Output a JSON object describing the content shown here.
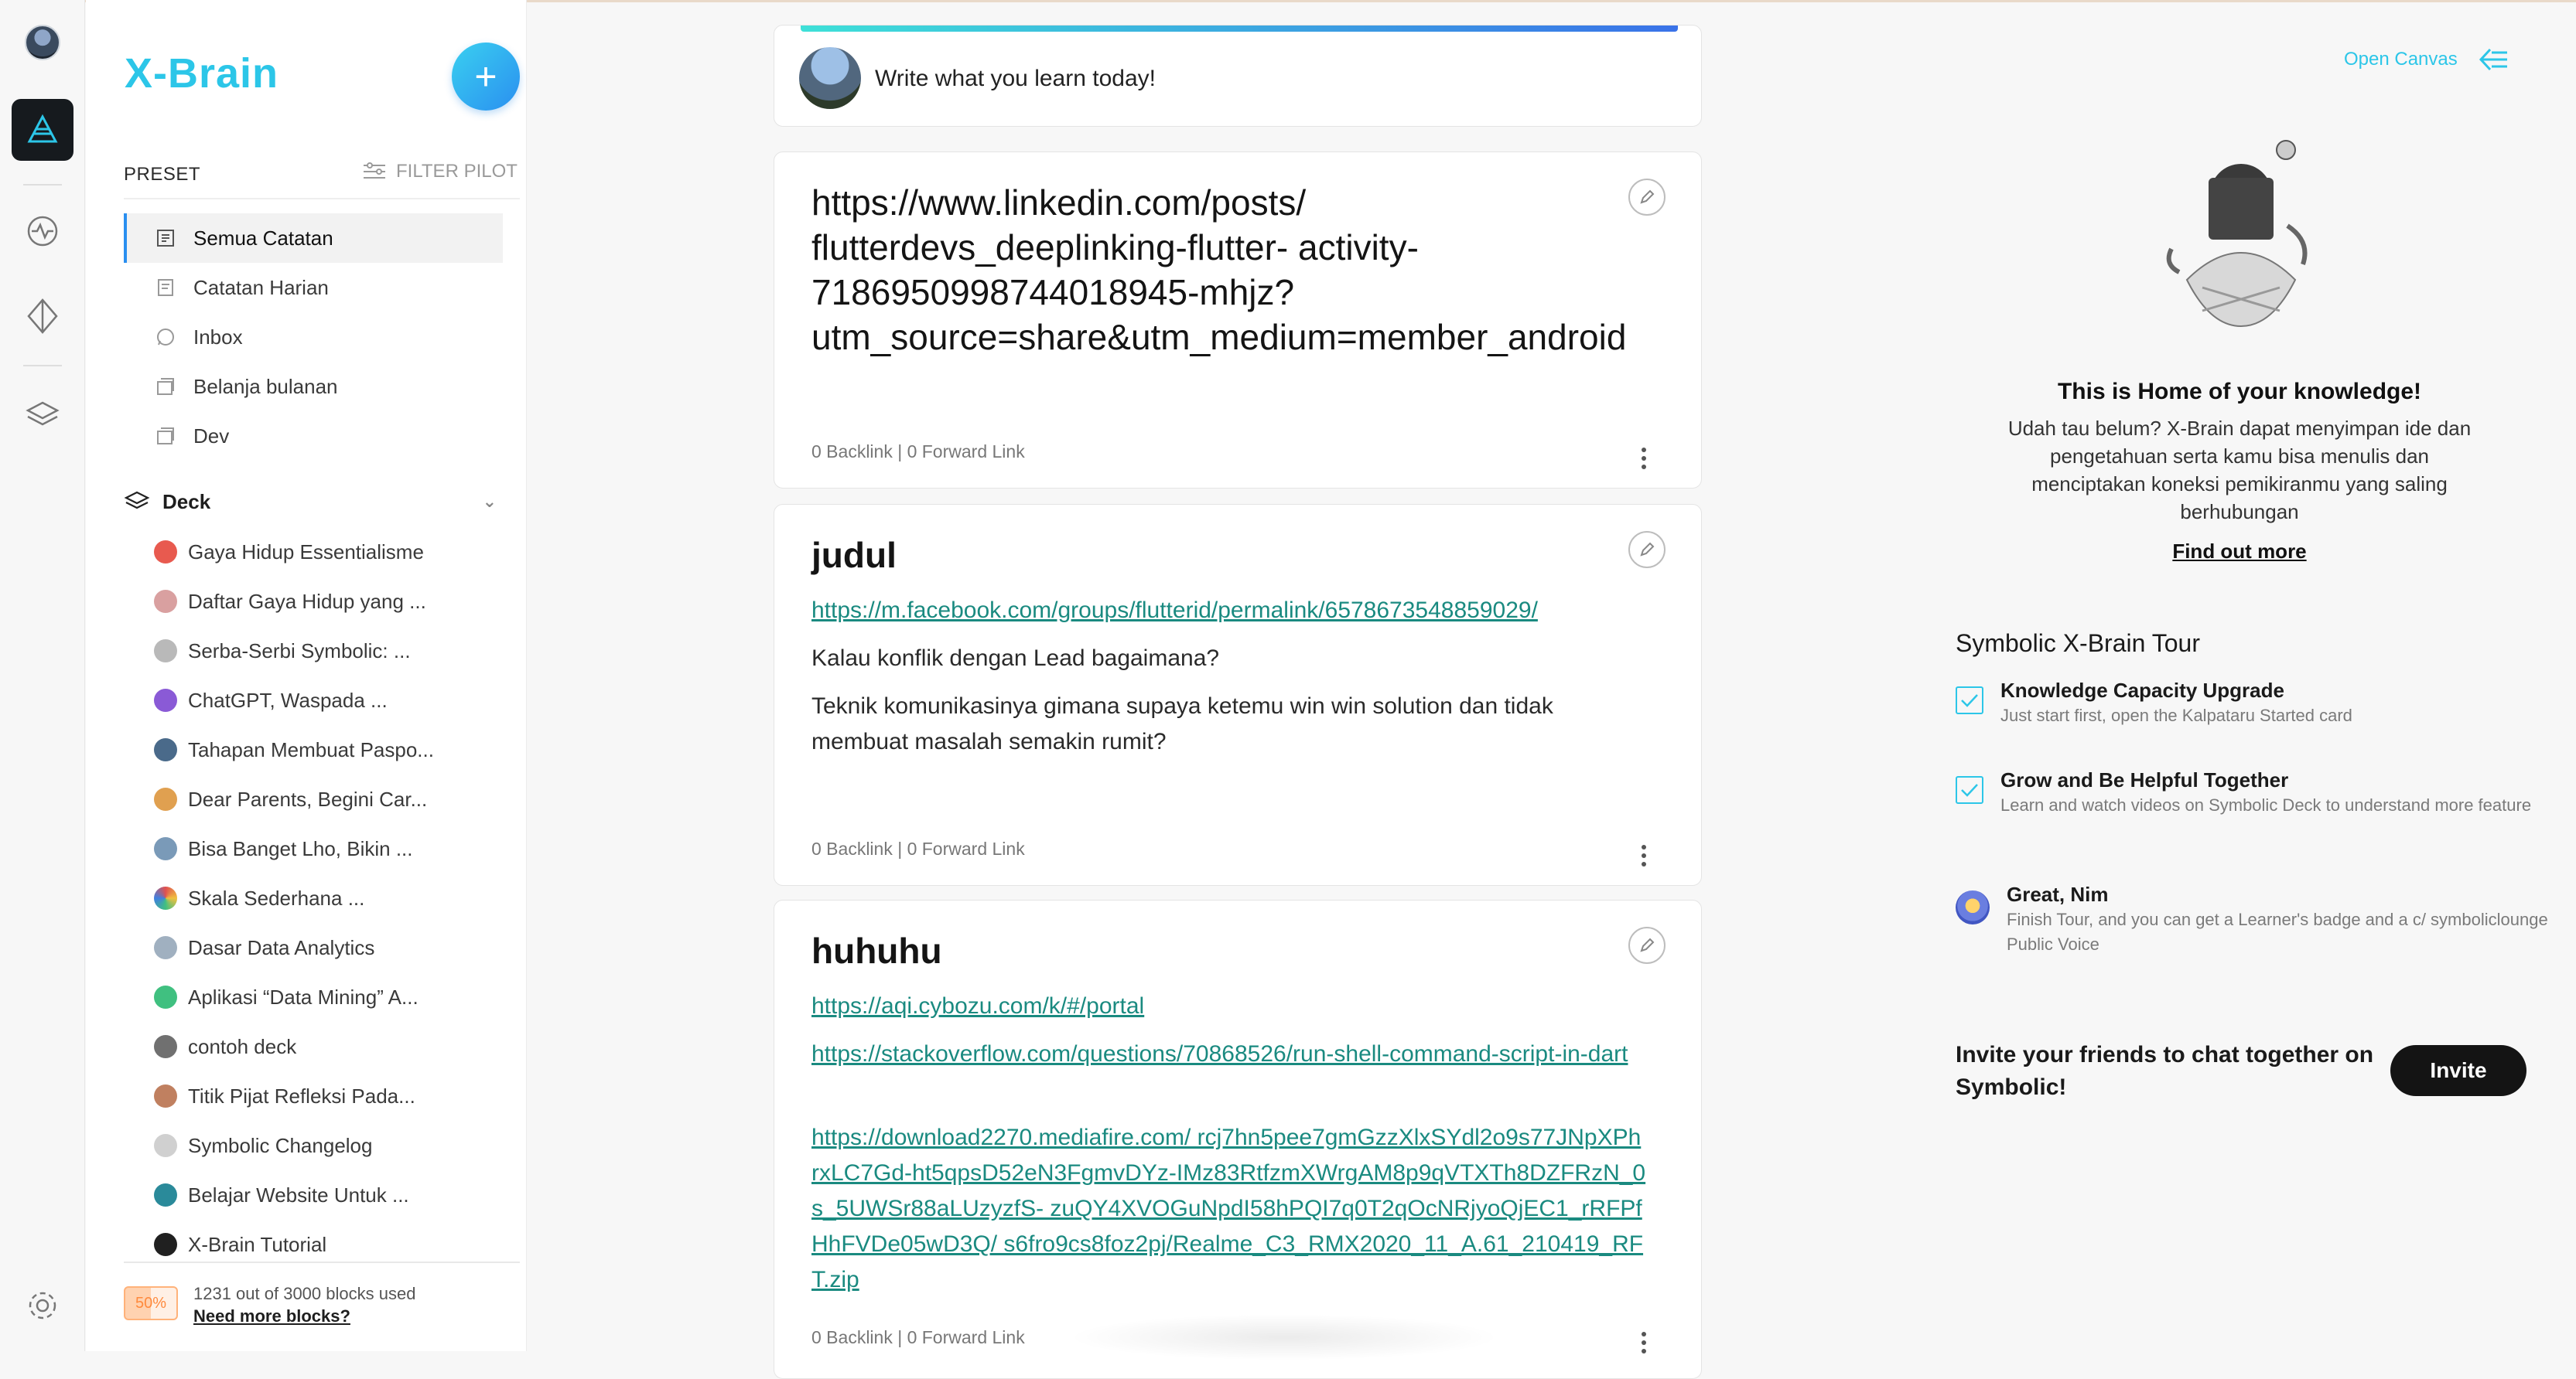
{
  "app": {
    "brand": "X-Brain",
    "add_label": "+"
  },
  "sidebar": {
    "preset_label": "PRESET",
    "filter_label": "FILTER PILOT",
    "nav": [
      {
        "label": "Semua Catatan",
        "icon": "notes-icon"
      },
      {
        "label": "Catatan Harian",
        "icon": "daily-note-icon"
      },
      {
        "label": "Inbox",
        "icon": "whatsapp-icon"
      },
      {
        "label": "Belanja bulanan",
        "icon": "folder-icon"
      },
      {
        "label": "Dev",
        "icon": "folder-icon"
      }
    ],
    "deck_label": "Deck",
    "decks": [
      {
        "label": "Gaya Hidup Essentialisme",
        "color": "#e85a4f"
      },
      {
        "label": "Daftar Gaya Hidup yang ...",
        "color": "#d9a0a0"
      },
      {
        "label": "Serba-Serbi Symbolic: ...",
        "color": "#b9b9b9"
      },
      {
        "label": "ChatGPT, Waspada ...",
        "color": "#8a5ad6"
      },
      {
        "label": "Tahapan Membuat Paspo...",
        "color": "#4a6a8a"
      },
      {
        "label": "Dear Parents, Begini Car...",
        "color": "#e0a050"
      },
      {
        "label": "Bisa Banget Lho, Bikin ...",
        "color": "#7a9ab8"
      },
      {
        "label": "Skala Sederhana ...",
        "color": "#e05050"
      },
      {
        "label": "Dasar Data Analytics",
        "color": "#a0b0c0"
      },
      {
        "label": "Aplikasi “Data Mining” A...",
        "color": "#40c080"
      },
      {
        "label": "contoh deck",
        "color": "#707070"
      },
      {
        "label": "Titik Pijat Refleksi Pada...",
        "color": "#c08060"
      },
      {
        "label": "Symbolic Changelog",
        "color": "#d0d0d0"
      },
      {
        "label": "Belajar Website Untuk ...",
        "color": "#2a8a9a"
      },
      {
        "label": "X-Brain Tutorial",
        "color": "#202020"
      }
    ],
    "usage": {
      "badge": "50%",
      "text": "1231 out of 3000 blocks used",
      "link": "Need more blocks?",
      "fraction": 0.41
    }
  },
  "composer": {
    "placeholder": "Write what you learn today!"
  },
  "cards": [
    {
      "title": "https://www.linkedin.com/posts/ flutterdevs_deeplinking-flutter- activity-7186950998744018945-mhjz? utm_source=share&utm_medium=member_android",
      "meta": "0 Backlink | 0 Forward Link"
    },
    {
      "title": "judul",
      "link": "https://m.facebook.com/groups/flutterid/permalink/6578673548859029/",
      "text1": "Kalau konflik dengan Lead bagaimana?",
      "text2": "Teknik komunikasinya gimana supaya ketemu win win solution dan tidak membuat masalah semakin rumit?",
      "meta": "0 Backlink | 0 Forward Link"
    },
    {
      "title": "huhuhu",
      "link1": "https://aqi.cybozu.com/k/#/portal",
      "link2": "https://stackoverflow.com/questions/70868526/run-shell-command-script-in-dart",
      "link3": "https://download2270.mediafire.com/ rcj7hn5pee7gmGzzXlxSYdl2o9s77JNpXPhrxLC7Gd-ht5qpsD52eN3FgmvDYz-IMz83RtfzmXWrgAM8p9qVTXTh8DZFRzN_0s_5UWSr88aLUzyzfS- zuQY4XVOGuNpdI58hPQI7q0T2qOcNRjyoQjEC1_rRFPfHhFVDe05wD3Q/ s6fro9cs8foz2pj/Realme_C3_RMX2020_11_A.61_210419_RFT.zip",
      "meta": "0 Backlink | 0 Forward Link"
    }
  ],
  "right": {
    "open_canvas": "Open Canvas",
    "home_title": "This is Home of your knowledge!",
    "home_desc": "Udah tau belum? X-Brain dapat menyimpan ide dan pengetahuan serta kamu bisa menulis dan menciptakan koneksi pemikiranmu yang saling berhubungan",
    "find_out": "Find out more",
    "tour_title": "Symbolic X-Brain Tour",
    "tour": [
      {
        "title": "Knowledge Capacity Upgrade",
        "desc": "Just start first, open the Kalpataru Started card"
      },
      {
        "title": "Grow and Be Helpful Together",
        "desc": "Learn and watch videos on Symbolic Deck to understand more feature"
      },
      {
        "title": "Great, Nim",
        "desc": "Finish Tour, and you can get a Learner's badge and a c/ symboliclounge Public Voice"
      }
    ],
    "invite_text": "Invite your friends to chat together on Symbolic!",
    "invite_button": "Invite"
  },
  "colors": {
    "accent": "#2cc6e8",
    "link": "#1a8a80",
    "active_rail": "#161a1e"
  }
}
